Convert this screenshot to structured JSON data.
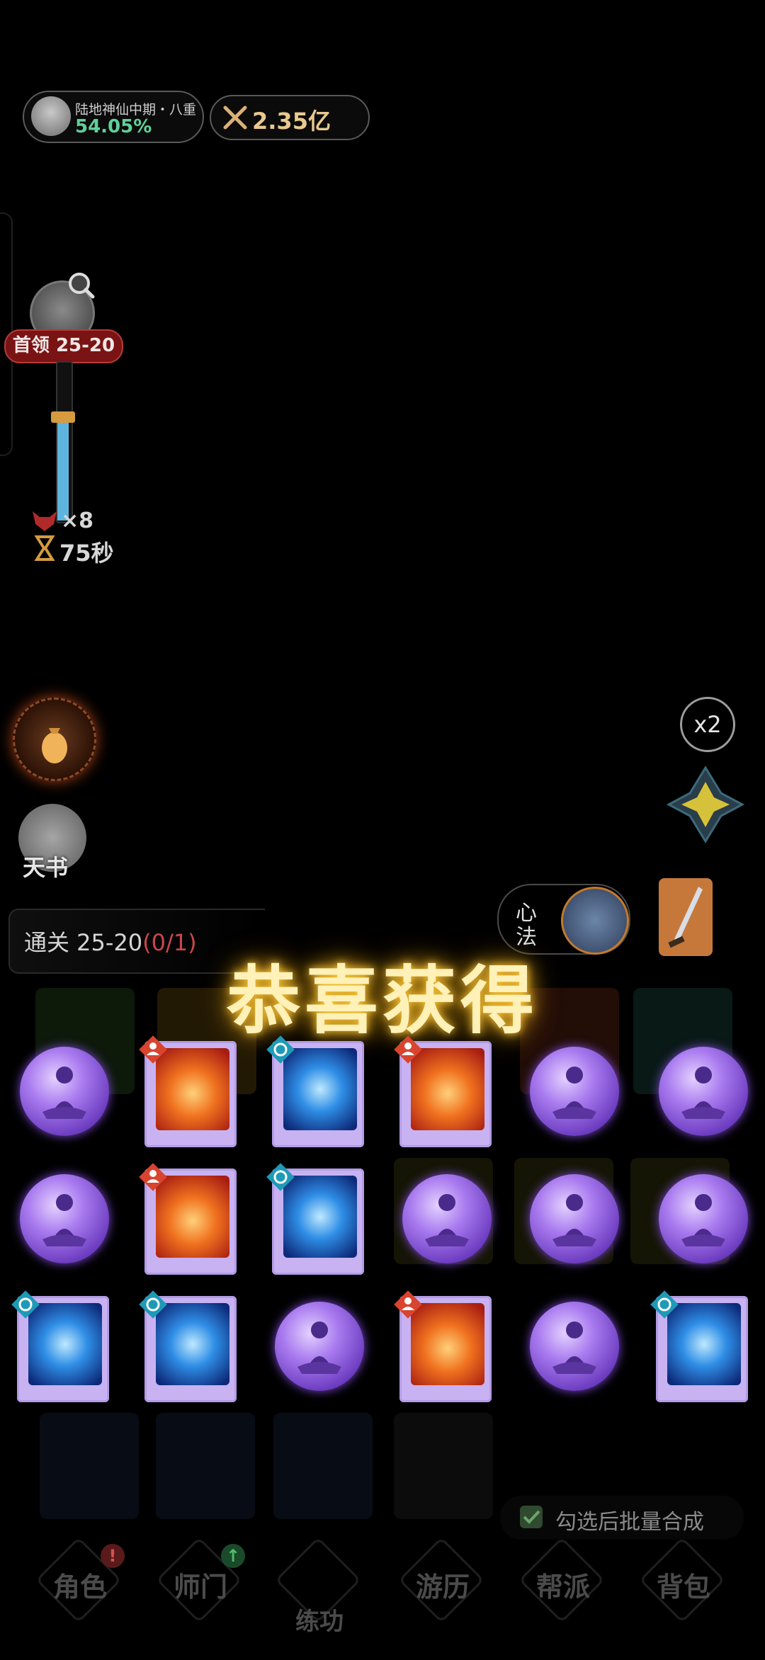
{
  "player": {
    "realm_title": "陆地神仙中期・八重",
    "realm_percent": "54.05%",
    "power": "2.35亿"
  },
  "boss": {
    "label": "首领 25-20",
    "progress": 0.65,
    "enemy_count": "×8",
    "timer": "75秒"
  },
  "side": {
    "skybook_label": "天书",
    "speed_label": "x2",
    "xinfa_label_1": "心",
    "xinfa_label_2": "法"
  },
  "clearance": {
    "prefix": "通关 25-20",
    "progress": "(0/1)"
  },
  "congrats": "恭喜获得",
  "rewards": [
    {
      "kind": "orb"
    },
    {
      "kind": "book",
      "element": "fire",
      "tag": "person"
    },
    {
      "kind": "book",
      "element": "water",
      "tag": "swirl"
    },
    {
      "kind": "book",
      "element": "fire",
      "tag": "person"
    },
    {
      "kind": "orb"
    },
    {
      "kind": "orb"
    },
    {
      "kind": "orb"
    },
    {
      "kind": "book",
      "element": "fire",
      "tag": "person"
    },
    {
      "kind": "book",
      "element": "water",
      "tag": "swirl"
    },
    {
      "kind": "orb"
    },
    {
      "kind": "orb"
    },
    {
      "kind": "orb"
    },
    {
      "kind": "book",
      "element": "water",
      "tag": "swirl"
    },
    {
      "kind": "book",
      "element": "water",
      "tag": "swirl"
    },
    {
      "kind": "orb"
    },
    {
      "kind": "book",
      "element": "fire",
      "tag": "person"
    },
    {
      "kind": "orb"
    },
    {
      "kind": "book",
      "element": "water",
      "tag": "swirl"
    }
  ],
  "merge": {
    "label": "勾选后批量合成",
    "checked": true
  },
  "nav": [
    {
      "label": "角色",
      "badge": "!"
    },
    {
      "label": "师门",
      "badge": "↑"
    },
    {
      "label": "练功",
      "badge": ""
    },
    {
      "label": "游历",
      "badge": ""
    },
    {
      "label": "帮派",
      "badge": ""
    },
    {
      "label": "背包",
      "badge": ""
    }
  ],
  "colors": {
    "accent_gold": "#ffc93a",
    "realm_green": "#5fd19a",
    "boss_red": "#7a1414",
    "progress_blue": "#5eb4de",
    "orb_purple": "#a97bef"
  }
}
